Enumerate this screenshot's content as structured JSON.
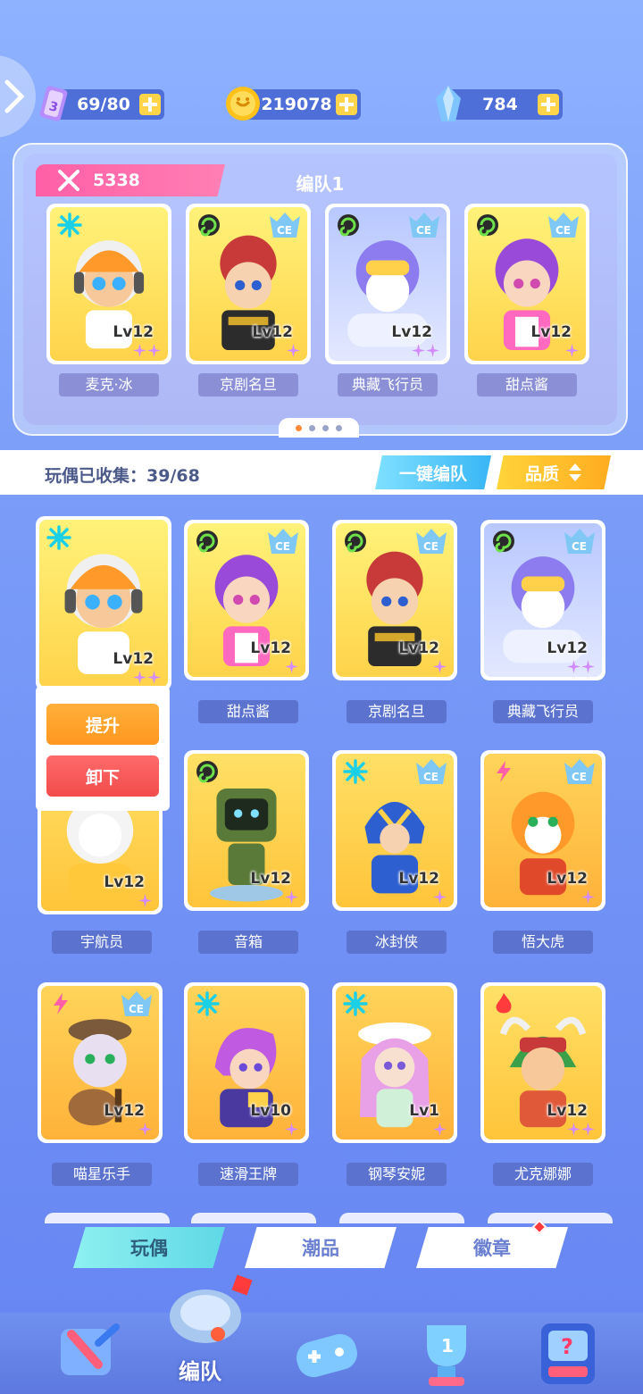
{
  "resources": {
    "stamina": {
      "value": "69/80",
      "icon": "stamina-card-icon"
    },
    "coins": {
      "value": "219078",
      "icon": "coin-icon"
    },
    "crystals": {
      "value": "784",
      "icon": "crystal-icon"
    }
  },
  "team": {
    "power": "5338",
    "name": "编队1",
    "members": [
      {
        "name": "麦克·冰",
        "level": "Lv12",
        "stars": 2,
        "element": "ice",
        "ce": false
      },
      {
        "name": "京剧名旦",
        "level": "Lv12",
        "stars": 1,
        "element": "wind",
        "ce": true
      },
      {
        "name": "典藏飞行员",
        "level": "Lv12",
        "stars": 2,
        "element": "wind",
        "ce": true
      },
      {
        "name": "甜点酱",
        "level": "Lv12",
        "stars": 1,
        "element": "wind",
        "ce": true
      }
    ]
  },
  "collection": {
    "label": "玩偶已收集：39/68",
    "auto_team_label": "一键编队",
    "quality_label": "品质"
  },
  "popup": {
    "upgrade_label": "提升",
    "remove_label": "卸下"
  },
  "grid": [
    {
      "name": "",
      "level": "Lv12",
      "stars": 2,
      "element": "ice",
      "ce": false
    },
    {
      "name": "甜点酱",
      "level": "Lv12",
      "stars": 1,
      "element": "wind",
      "ce": true
    },
    {
      "name": "京剧名旦",
      "level": "Lv12",
      "stars": 1,
      "element": "wind",
      "ce": true
    },
    {
      "name": "典藏飞行员",
      "level": "Lv12",
      "stars": 2,
      "element": "wind",
      "ce": true
    },
    {
      "name": "宇航员",
      "level": "Lv12",
      "stars": 1,
      "element": "",
      "ce": false
    },
    {
      "name": "音箱",
      "level": "Lv12",
      "stars": 1,
      "element": "wind",
      "ce": false
    },
    {
      "name": "冰封侠",
      "level": "Lv12",
      "stars": 1,
      "element": "ice",
      "ce": true
    },
    {
      "name": "悟大虎",
      "level": "Lv12",
      "stars": 1,
      "element": "thunder",
      "ce": true
    },
    {
      "name": "喵星乐手",
      "level": "Lv12",
      "stars": 1,
      "element": "thunder",
      "ce": true
    },
    {
      "name": "速滑王牌",
      "level": "Lv10",
      "stars": 1,
      "element": "ice",
      "ce": false
    },
    {
      "name": "钢琴安妮",
      "level": "Lv1",
      "stars": 1,
      "element": "ice",
      "ce": false
    },
    {
      "name": "尤克娜娜",
      "level": "Lv12",
      "stars": 2,
      "element": "fire",
      "ce": false
    }
  ],
  "tabs": [
    {
      "label": "玩偶",
      "active": true
    },
    {
      "label": "潮品",
      "active": false
    },
    {
      "label": "徽章",
      "active": false
    }
  ],
  "nav": {
    "active_label": "编队",
    "items": [
      "collection-icon",
      "team-whistle-icon",
      "gamepad-icon",
      "trophy-icon",
      "mystery-box-icon"
    ]
  },
  "colors": {
    "accent_pink": "#ff5fa6",
    "accent_cyan": "#39b6f5",
    "accent_gold": "#ffac20",
    "star_purple": "#d38cff"
  }
}
